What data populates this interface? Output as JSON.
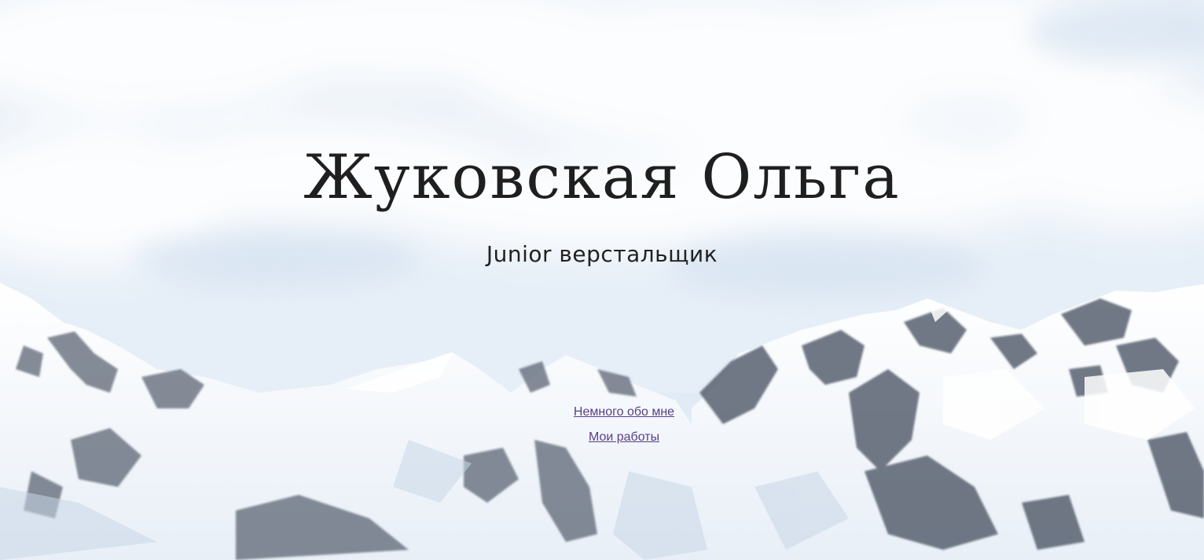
{
  "hero": {
    "title": "Жуковская Ольга",
    "subtitle": "Junior верстальщик"
  },
  "nav": {
    "items": [
      {
        "label": "Немного обо мне"
      },
      {
        "label": "Мои работы"
      }
    ]
  },
  "colors": {
    "title": "#1f1f1f",
    "link": "#5a3f86",
    "sky": "#e9f1f9",
    "snow": "#f7fafd",
    "rock": "#5d6675"
  }
}
